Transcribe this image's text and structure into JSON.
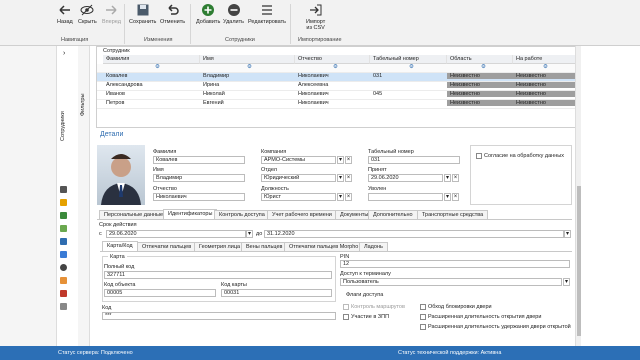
{
  "ribbon": {
    "back": "Назад",
    "hide": "Скрыть",
    "forward": "Вперед",
    "save": "Сохранить",
    "cancel": "Отменить",
    "add": "Добавить",
    "delete": "Удалить",
    "edit": "Редактировать",
    "import_l1": "Импорт",
    "import_l2": "из CSV",
    "groups": {
      "nav": "Навигация",
      "changes": "Изменения",
      "employees": "Сотрудники",
      "importing": "Импортирование"
    }
  },
  "rail": {
    "filters": "Фильтры",
    "employees": "Сотрудники"
  },
  "grid": {
    "title": "Сотрудник",
    "columns": [
      "Фамилия",
      "Имя",
      "Отчество",
      "Табельный номер",
      "Область",
      "На работе"
    ],
    "rows": [
      [
        "Ковалев",
        "Владимир",
        "Николаевич",
        "031",
        "Неизвестно",
        "Неизвестно"
      ],
      [
        "Александрова",
        "Ирина",
        "Алексеевна",
        "",
        "Неизвестно",
        "Неизвестно"
      ],
      [
        "Иванов",
        "Николай",
        "Николаевич",
        "045",
        "Неизвестно",
        "Неизвестно"
      ],
      [
        "Петров",
        "Евгений",
        "Николаевич",
        "",
        "Неизвестно",
        "Неизвестно"
      ]
    ]
  },
  "details": {
    "title": "Детали",
    "surname_label": "Фамилия",
    "surname": "Ковалев",
    "name_label": "Имя",
    "name": "Владимир",
    "patronymic_label": "Отчество",
    "patronymic": "Николаевич",
    "company_label": "Компания",
    "company": "АРМО-Системы",
    "dept_label": "Отдел",
    "dept": "Юридический",
    "position_label": "Должность",
    "position": "Юрист",
    "tabnum_label": "Табельный номер",
    "tabnum": "031",
    "hired_label": "Принят",
    "hired": "29.06.2020",
    "fired_label": "Уволен",
    "fired": "",
    "consent": "Согласие на обработку данных",
    "tabs": [
      "Персональные данные",
      "Идентификаторы",
      "Контроль доступа",
      "Учет рабочего времени",
      "Документы",
      "Дополнительно",
      "Транспортные средства"
    ],
    "validity_label": "Срок действия",
    "from_prefix": "с",
    "from": "29.06.2020",
    "to_prefix": "до",
    "to": "31.12.2020",
    "subtabs": [
      "Карта/Код",
      "Отпечатки пальцев",
      "Геометрия лица",
      "Вены пальцев",
      "Отпечатки пальцев Morpho",
      "Ладонь"
    ],
    "card_label": "Карта",
    "full_code_label": "Полный код",
    "full_code": "327711",
    "obj_code_label": "Код объекта",
    "obj_code": "00005",
    "card_code_label": "Код карты",
    "card_code": "00031",
    "code_label": "Код",
    "code": "***",
    "pin_label": "PIN",
    "pin": "12",
    "access_label": "Доступ к терминалу",
    "access": "Пользователь",
    "flags_label": "Флаги доступа",
    "flags_left": [
      "Контроль маршрутов",
      "Участие в ЗПП"
    ],
    "flags_right": [
      "Обход блокировки двери",
      "Расширенная длительность открытия двери",
      "Расширенная длительность удержания двери открытой"
    ]
  },
  "status": {
    "server": "Статус сервера: Подключено",
    "support": "Статус технической поддержки: Активна"
  }
}
